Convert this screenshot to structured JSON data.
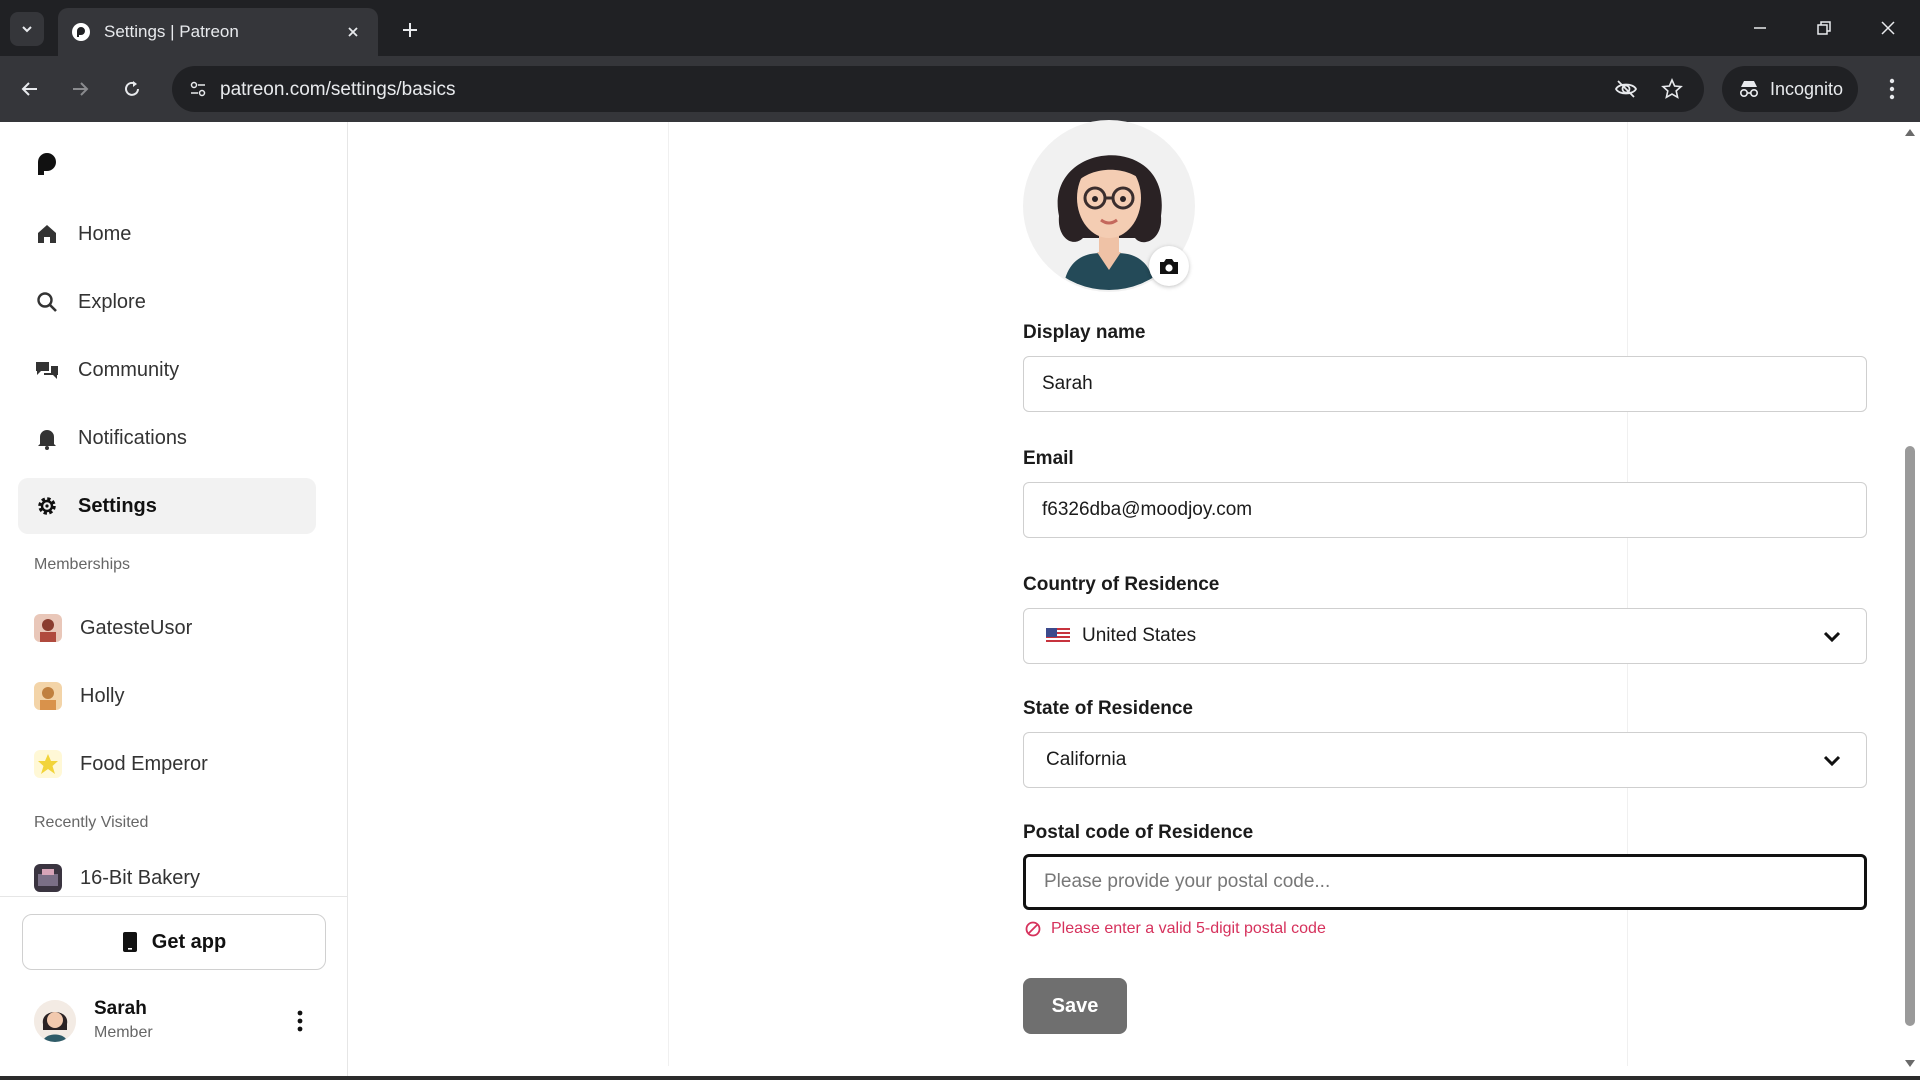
{
  "browser": {
    "tab_title": "Settings | Patreon",
    "url": "patreon.com/settings/basics",
    "incognito_label": "Incognito"
  },
  "sidebar": {
    "nav": [
      {
        "label": "Home",
        "icon": "home-icon"
      },
      {
        "label": "Explore",
        "icon": "search-icon"
      },
      {
        "label": "Community",
        "icon": "chat-bubbles-icon"
      },
      {
        "label": "Notifications",
        "icon": "bell-icon"
      },
      {
        "label": "Settings",
        "icon": "gear-icon",
        "active": true
      }
    ],
    "memberships_heading": "Memberships",
    "memberships": [
      {
        "label": "GatesteUsor"
      },
      {
        "label": "Holly"
      },
      {
        "label": "Food Emperor"
      }
    ],
    "recent_heading": "Recently Visited",
    "recent": [
      {
        "label": "16-Bit Bakery"
      }
    ],
    "get_app_label": "Get app",
    "user": {
      "name": "Sarah",
      "role": "Member"
    }
  },
  "form": {
    "display_name": {
      "label": "Display name",
      "value": "Sarah"
    },
    "email": {
      "label": "Email",
      "value": "f6326dba@moodjoy.com"
    },
    "country": {
      "label": "Country of Residence",
      "value": "United States"
    },
    "state": {
      "label": "State of Residence",
      "value": "California"
    },
    "postal": {
      "label": "Postal code of Residence",
      "placeholder": "Please provide your postal code...",
      "value": ""
    },
    "error": "Please enter a valid 5-digit postal code",
    "save_label": "Save"
  },
  "colors": {
    "error": "#d6315c",
    "save_button": "#6f6f6f",
    "chrome_dark": "#202124"
  }
}
